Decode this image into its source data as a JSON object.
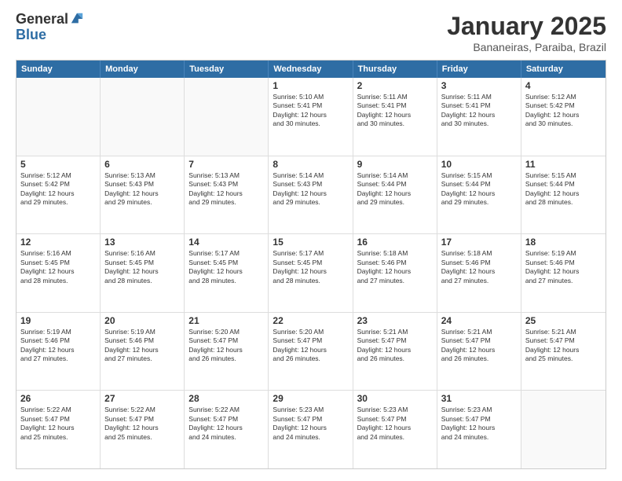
{
  "logo": {
    "general": "General",
    "blue": "Blue"
  },
  "header": {
    "title": "January 2025",
    "subtitle": "Bananeiras, Paraiba, Brazil"
  },
  "weekdays": [
    "Sunday",
    "Monday",
    "Tuesday",
    "Wednesday",
    "Thursday",
    "Friday",
    "Saturday"
  ],
  "rows": [
    [
      {
        "day": "",
        "info": ""
      },
      {
        "day": "",
        "info": ""
      },
      {
        "day": "",
        "info": ""
      },
      {
        "day": "1",
        "info": "Sunrise: 5:10 AM\nSunset: 5:41 PM\nDaylight: 12 hours\nand 30 minutes."
      },
      {
        "day": "2",
        "info": "Sunrise: 5:11 AM\nSunset: 5:41 PM\nDaylight: 12 hours\nand 30 minutes."
      },
      {
        "day": "3",
        "info": "Sunrise: 5:11 AM\nSunset: 5:41 PM\nDaylight: 12 hours\nand 30 minutes."
      },
      {
        "day": "4",
        "info": "Sunrise: 5:12 AM\nSunset: 5:42 PM\nDaylight: 12 hours\nand 30 minutes."
      }
    ],
    [
      {
        "day": "5",
        "info": "Sunrise: 5:12 AM\nSunset: 5:42 PM\nDaylight: 12 hours\nand 29 minutes."
      },
      {
        "day": "6",
        "info": "Sunrise: 5:13 AM\nSunset: 5:43 PM\nDaylight: 12 hours\nand 29 minutes."
      },
      {
        "day": "7",
        "info": "Sunrise: 5:13 AM\nSunset: 5:43 PM\nDaylight: 12 hours\nand 29 minutes."
      },
      {
        "day": "8",
        "info": "Sunrise: 5:14 AM\nSunset: 5:43 PM\nDaylight: 12 hours\nand 29 minutes."
      },
      {
        "day": "9",
        "info": "Sunrise: 5:14 AM\nSunset: 5:44 PM\nDaylight: 12 hours\nand 29 minutes."
      },
      {
        "day": "10",
        "info": "Sunrise: 5:15 AM\nSunset: 5:44 PM\nDaylight: 12 hours\nand 29 minutes."
      },
      {
        "day": "11",
        "info": "Sunrise: 5:15 AM\nSunset: 5:44 PM\nDaylight: 12 hours\nand 28 minutes."
      }
    ],
    [
      {
        "day": "12",
        "info": "Sunrise: 5:16 AM\nSunset: 5:45 PM\nDaylight: 12 hours\nand 28 minutes."
      },
      {
        "day": "13",
        "info": "Sunrise: 5:16 AM\nSunset: 5:45 PM\nDaylight: 12 hours\nand 28 minutes."
      },
      {
        "day": "14",
        "info": "Sunrise: 5:17 AM\nSunset: 5:45 PM\nDaylight: 12 hours\nand 28 minutes."
      },
      {
        "day": "15",
        "info": "Sunrise: 5:17 AM\nSunset: 5:45 PM\nDaylight: 12 hours\nand 28 minutes."
      },
      {
        "day": "16",
        "info": "Sunrise: 5:18 AM\nSunset: 5:46 PM\nDaylight: 12 hours\nand 27 minutes."
      },
      {
        "day": "17",
        "info": "Sunrise: 5:18 AM\nSunset: 5:46 PM\nDaylight: 12 hours\nand 27 minutes."
      },
      {
        "day": "18",
        "info": "Sunrise: 5:19 AM\nSunset: 5:46 PM\nDaylight: 12 hours\nand 27 minutes."
      }
    ],
    [
      {
        "day": "19",
        "info": "Sunrise: 5:19 AM\nSunset: 5:46 PM\nDaylight: 12 hours\nand 27 minutes."
      },
      {
        "day": "20",
        "info": "Sunrise: 5:19 AM\nSunset: 5:46 PM\nDaylight: 12 hours\nand 27 minutes."
      },
      {
        "day": "21",
        "info": "Sunrise: 5:20 AM\nSunset: 5:47 PM\nDaylight: 12 hours\nand 26 minutes."
      },
      {
        "day": "22",
        "info": "Sunrise: 5:20 AM\nSunset: 5:47 PM\nDaylight: 12 hours\nand 26 minutes."
      },
      {
        "day": "23",
        "info": "Sunrise: 5:21 AM\nSunset: 5:47 PM\nDaylight: 12 hours\nand 26 minutes."
      },
      {
        "day": "24",
        "info": "Sunrise: 5:21 AM\nSunset: 5:47 PM\nDaylight: 12 hours\nand 26 minutes."
      },
      {
        "day": "25",
        "info": "Sunrise: 5:21 AM\nSunset: 5:47 PM\nDaylight: 12 hours\nand 25 minutes."
      }
    ],
    [
      {
        "day": "26",
        "info": "Sunrise: 5:22 AM\nSunset: 5:47 PM\nDaylight: 12 hours\nand 25 minutes."
      },
      {
        "day": "27",
        "info": "Sunrise: 5:22 AM\nSunset: 5:47 PM\nDaylight: 12 hours\nand 25 minutes."
      },
      {
        "day": "28",
        "info": "Sunrise: 5:22 AM\nSunset: 5:47 PM\nDaylight: 12 hours\nand 24 minutes."
      },
      {
        "day": "29",
        "info": "Sunrise: 5:23 AM\nSunset: 5:47 PM\nDaylight: 12 hours\nand 24 minutes."
      },
      {
        "day": "30",
        "info": "Sunrise: 5:23 AM\nSunset: 5:47 PM\nDaylight: 12 hours\nand 24 minutes."
      },
      {
        "day": "31",
        "info": "Sunrise: 5:23 AM\nSunset: 5:47 PM\nDaylight: 12 hours\nand 24 minutes."
      },
      {
        "day": "",
        "info": ""
      }
    ]
  ]
}
